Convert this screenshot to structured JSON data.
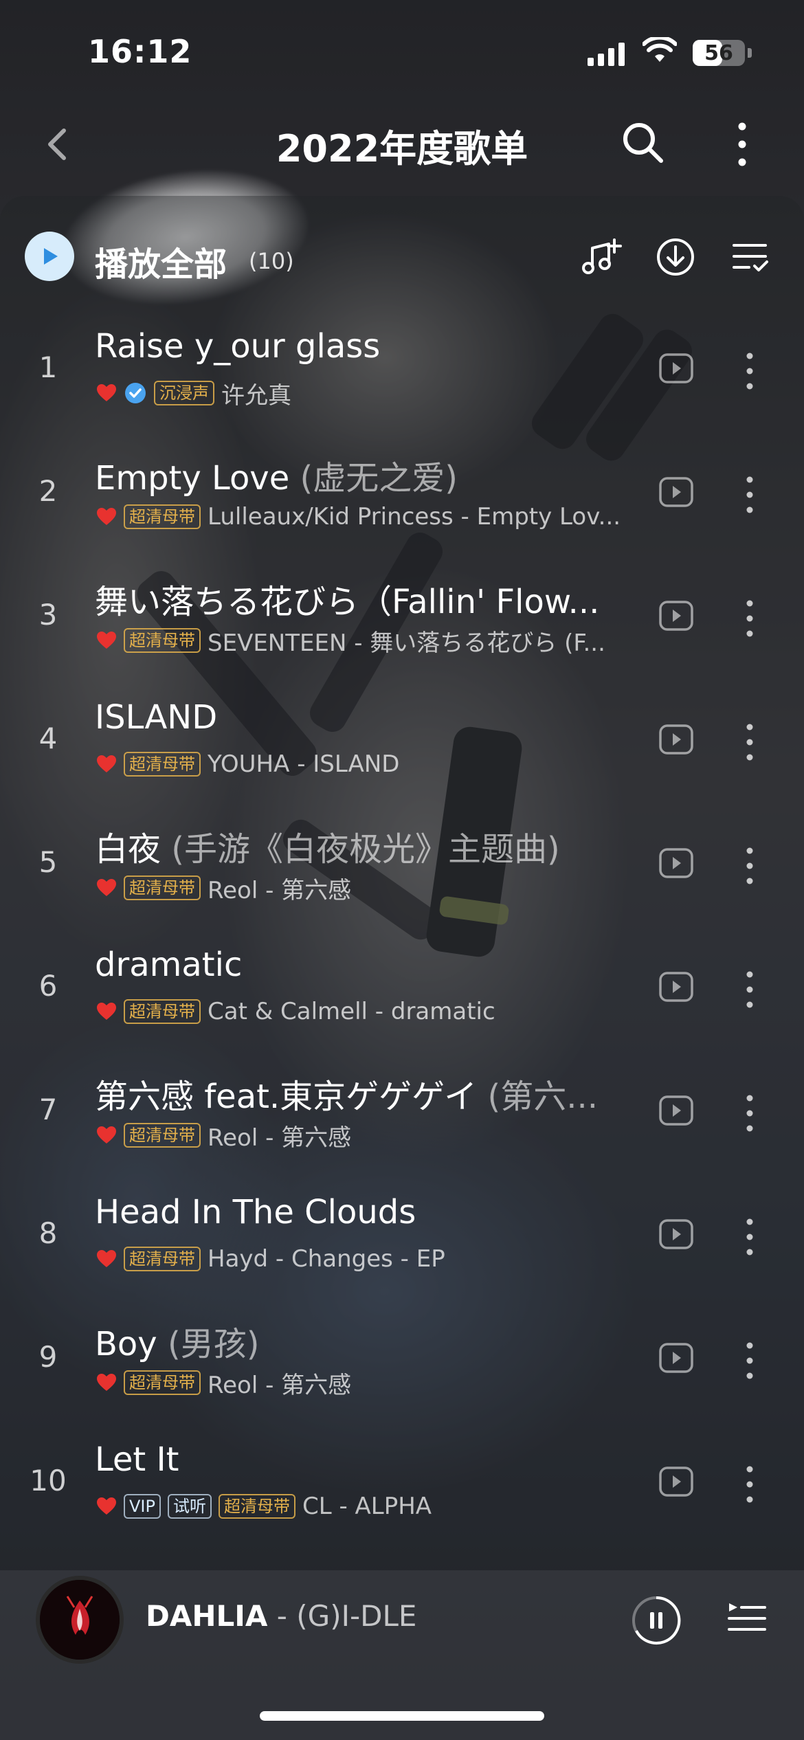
{
  "status_bar": {
    "time": "16:12",
    "battery": "56",
    "battery_fraction": 0.56
  },
  "nav": {
    "title": "2022年度歌单"
  },
  "list_header": {
    "play_all_label": "播放全部",
    "count": "(10)"
  },
  "songs": [
    {
      "index": "1",
      "title": "Raise y_our glass",
      "subtitle": "",
      "tags": [],
      "verified": true,
      "prefix_tag": "沉浸声",
      "artist": "许允真"
    },
    {
      "index": "2",
      "title": "Empty Love",
      "subtitle": "(虚无之爱)",
      "tags": [
        "超清母带"
      ],
      "artist": "Lulleaux/Kid Princess - Empty Lov..."
    },
    {
      "index": "3",
      "title": "舞い落ちる花びら（Fallin' Flow...",
      "subtitle": "",
      "tags": [
        "超清母带"
      ],
      "artist": "SEVENTEEN - 舞い落ちる花びら (F..."
    },
    {
      "index": "4",
      "title": "ISLAND",
      "subtitle": "",
      "tags": [
        "超清母带"
      ],
      "artist": "YOUHA - ISLAND"
    },
    {
      "index": "5",
      "title": "白夜",
      "subtitle": "(手游《白夜极光》主题曲)",
      "tags": [
        "超清母带"
      ],
      "artist": "Reol - 第六感"
    },
    {
      "index": "6",
      "title": "dramatic",
      "subtitle": "",
      "tags": [
        "超清母带"
      ],
      "artist": "Cat & Calmell - dramatic"
    },
    {
      "index": "7",
      "title": "第六感 feat.東京ゲゲゲイ",
      "subtitle": "(第六...",
      "tags": [
        "超清母带"
      ],
      "artist": "Reol - 第六感"
    },
    {
      "index": "8",
      "title": "Head In The Clouds",
      "subtitle": "",
      "tags": [
        "超清母带"
      ],
      "artist": "Hayd - Changes - EP"
    },
    {
      "index": "9",
      "title": "Boy",
      "subtitle": "(男孩)",
      "tags": [
        "超清母带"
      ],
      "artist": "Reol - 第六感"
    },
    {
      "index": "10",
      "title": "Let It",
      "subtitle": "",
      "tags": [
        "VIP",
        "试听",
        "超清母带"
      ],
      "artist": "CL - ALPHA"
    }
  ],
  "now_playing": {
    "title": "DAHLIA",
    "separator": " - ",
    "artist": "(G)I-DLE"
  },
  "icons": {
    "back": "chevron-left-icon",
    "search": "search-icon",
    "more": "more-vertical-icon",
    "play_all": "play-icon",
    "add_to_playlist": "music-add-icon",
    "download": "download-icon",
    "multi_select": "list-check-icon",
    "heart": "heart-icon",
    "row_play": "video-play-icon",
    "row_more": "more-vertical-icon",
    "pause": "pause-icon",
    "queue": "playlist-icon"
  },
  "colors": {
    "accent_play": "#d7ecfb",
    "heart": "#e8322f",
    "tag_gold": "#e3b04b",
    "verified_blue": "#4aa3ef"
  }
}
